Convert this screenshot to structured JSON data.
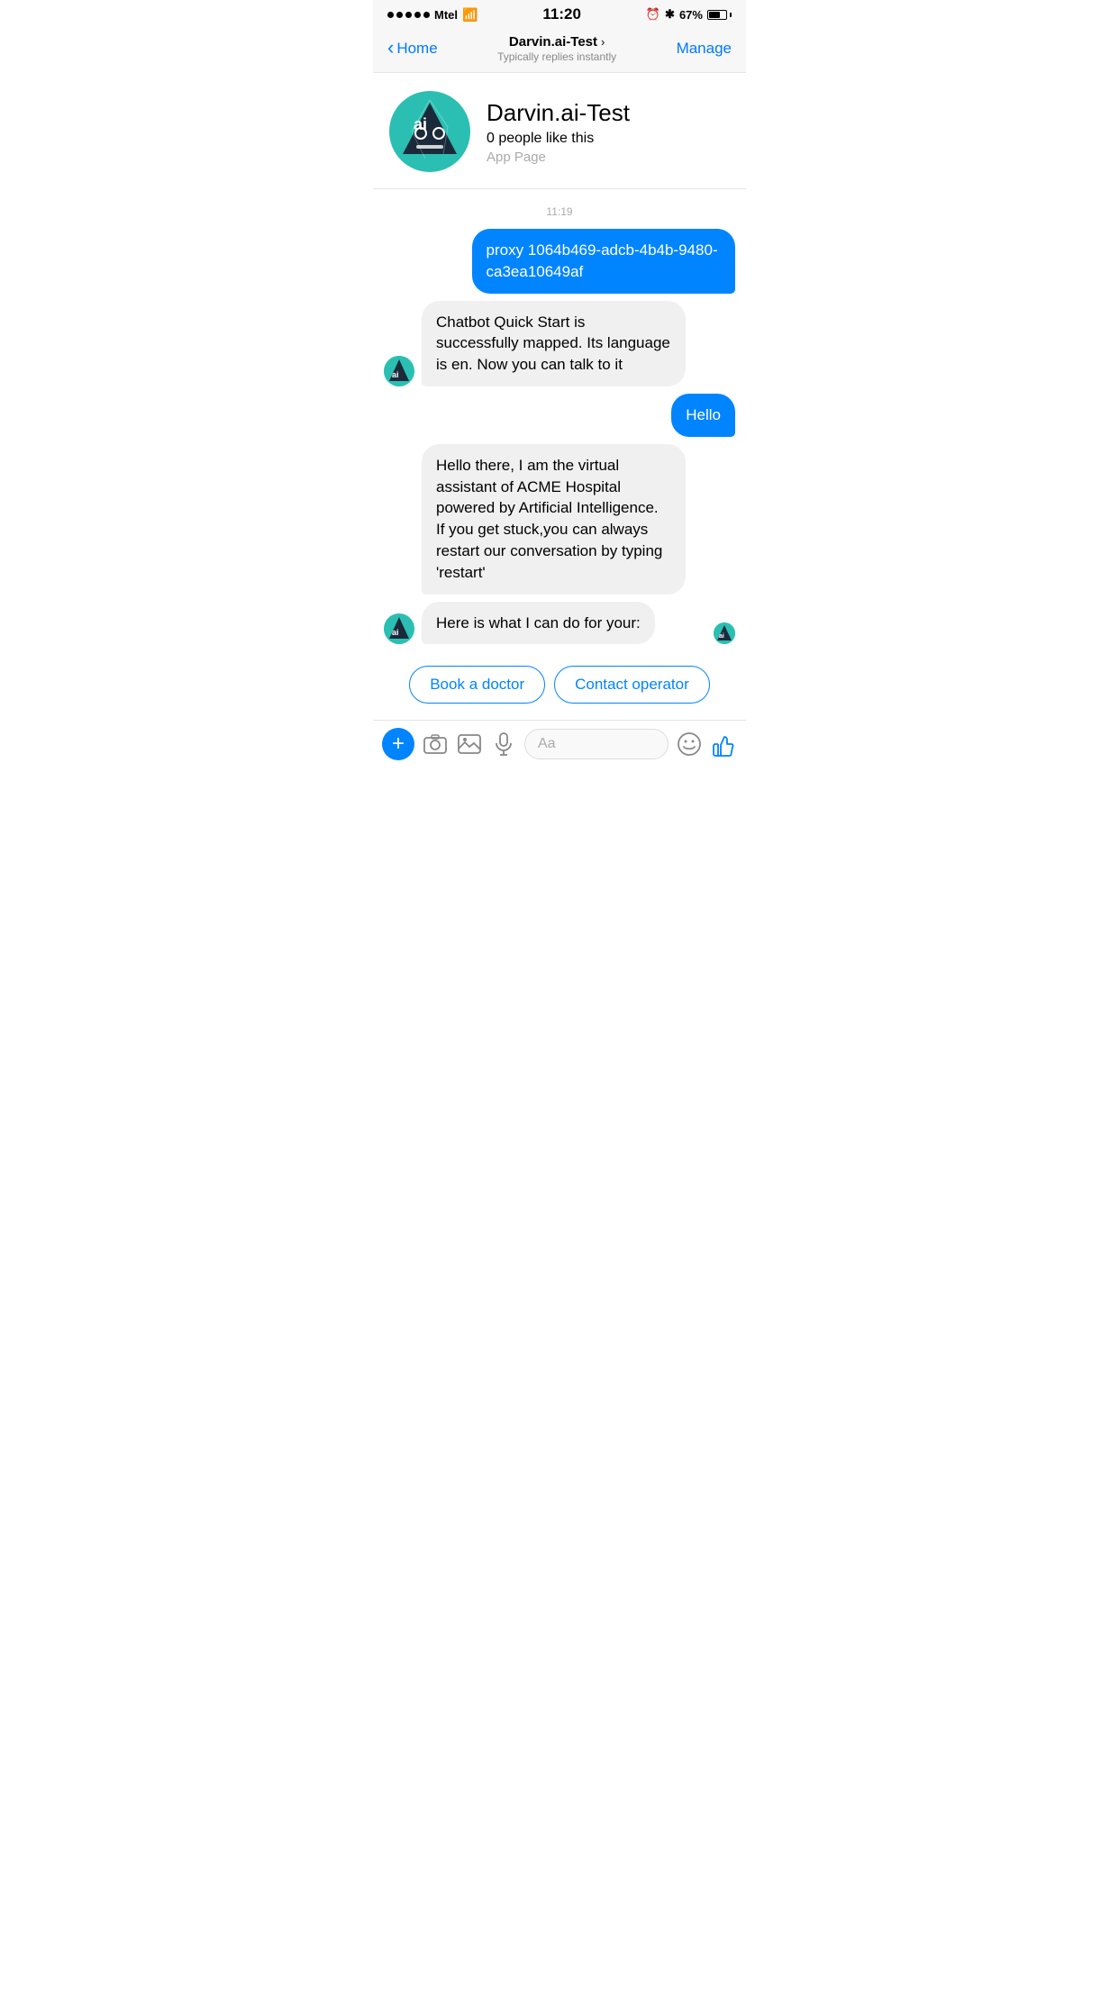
{
  "status_bar": {
    "carrier": "Mtel",
    "time": "11:20",
    "battery_pct": "67%"
  },
  "nav": {
    "back_label": "Home",
    "title": "Darvin.ai-Test",
    "subtitle": "Typically replies instantly",
    "manage_label": "Manage"
  },
  "profile": {
    "name": "Darvin.ai-Test",
    "likes": "0 people like this",
    "type": "App Page"
  },
  "chat": {
    "timestamp": "11:19",
    "messages": [
      {
        "id": "msg1",
        "direction": "outgoing",
        "text": "proxy 1064b469-adcb-4b4b-9480-ca3ea10649af"
      },
      {
        "id": "msg2",
        "direction": "incoming",
        "text": "Chatbot Quick Start is successfully mapped. Its language is en. Now you can talk to it"
      },
      {
        "id": "msg3",
        "direction": "outgoing",
        "text": "Hello"
      },
      {
        "id": "msg4",
        "direction": "incoming",
        "text": "Hello there, I am the virtual assistant of ACME Hospital powered by Artificial Intelligence. If you get stuck,you can always restart our conversation by typing 'restart'"
      },
      {
        "id": "msg5",
        "direction": "incoming",
        "text": "Here is what I can do for your:"
      }
    ],
    "quick_replies": [
      {
        "id": "qr1",
        "label": "Book a doctor"
      },
      {
        "id": "qr2",
        "label": "Contact operator"
      }
    ]
  },
  "toolbar": {
    "input_placeholder": "Aa",
    "plus_label": "+",
    "thumb_label": "👍"
  }
}
